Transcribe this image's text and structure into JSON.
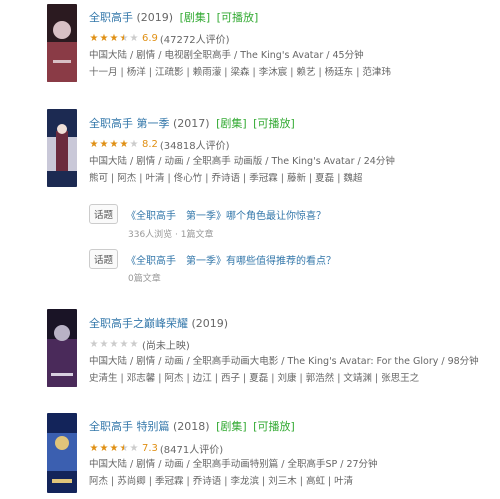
{
  "results": [
    {
      "title": "全职高手",
      "year": "(2019)",
      "tags": [
        "[剧集]",
        "[可播放]"
      ],
      "stars": [
        1,
        1,
        1,
        0.5,
        0
      ],
      "score": "6.9",
      "ratings": "(47272人评价)",
      "meta1": "中国大陆 / 剧情 / 电视剧全职高手 / The King's Avatar / 45分钟",
      "meta2": "十一月 | 杨洋 | 江疏影 | 赖雨濛 | 梁森 | 李沐宸 | 赖艺 | 杨廷东 | 范津玮",
      "poster_colors": [
        "#2b1a20",
        "#8a3b46",
        "#d8c0c5"
      ]
    },
    {
      "title": "全职高手 第一季",
      "year": "(2017)",
      "tags": [
        "[剧集]",
        "[可播放]"
      ],
      "stars": [
        1,
        1,
        1,
        1,
        0
      ],
      "score": "8.2",
      "ratings": "(34818人评价)",
      "meta1": "中国大陆 / 剧情 / 动画 / 全职高手 动画版 / The King's Avatar / 24分钟",
      "meta2": "熊可 | 阿杰 | 叶清 | 佟心竹 | 乔诗语 | 季冠霖 | 藤新 | 夏磊 | 魏超",
      "poster_colors": [
        "#1c2a52",
        "#6b2b3e",
        "#c9c8d8"
      ],
      "topics": [
        {
          "badge": "话题",
          "title": "《全职高手　第一季》哪个角色最让你惊喜？",
          "stats": "336人浏览 · 1篇文章"
        },
        {
          "badge": "话题",
          "title": "《全职高手　第一季》有哪些值得推荐的看点？",
          "stats": "0篇文章"
        }
      ]
    },
    {
      "title": "全职高手之巅峰荣耀",
      "year": "(2019)",
      "tags": [],
      "stars": [
        0,
        0,
        0,
        0,
        0
      ],
      "score": "",
      "ratings": "(尚未上映)",
      "meta1": "中国大陆 / 剧情 / 动画 / 全职高手动画大电影 / The King's Avatar: For the Glory / 98分钟",
      "meta2": "史清生 | 邓志馨 | 阿杰 | 边江 | 西子 | 夏磊 | 刘康 | 郭浩然 | 文靖渊 | 张思王之",
      "poster_colors": [
        "#1a1426",
        "#4a2a5a",
        "#b9b2c6"
      ]
    },
    {
      "title": "全职高手 特别篇",
      "year": "(2018)",
      "tags": [
        "[剧集]",
        "[可播放]"
      ],
      "stars": [
        1,
        1,
        1,
        0.5,
        0
      ],
      "score": "7.3",
      "ratings": "(8471人评价)",
      "meta1": "中国大陆 / 剧情 / 动画 / 全职高手动画特别篇 / 全职高手SP / 27分钟",
      "meta2": "阿杰 | 苏尚卿 | 季冠霖 | 乔诗语 | 李龙滨 | 刘三木 | 高虹 | 叶清",
      "poster_colors": [
        "#13245a",
        "#3b5fb0",
        "#e0c47a"
      ]
    }
  ]
}
